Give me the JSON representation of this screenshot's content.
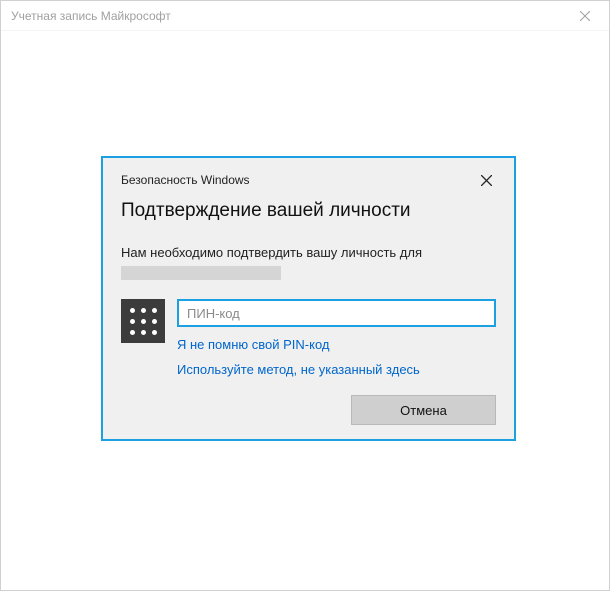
{
  "outer": {
    "title": "Учетная запись Майкрософт"
  },
  "dialog": {
    "small_title": "Безопасность Windows",
    "heading": "Подтверждение вашей личности",
    "body_text": "Нам необходимо подтвердить вашу личность для",
    "pin_placeholder": "ПИН-код",
    "forgot_link": "Я не помню свой PIN-код",
    "other_method_link": "Используйте метод, не указанный здесь",
    "cancel_label": "Отмена"
  }
}
